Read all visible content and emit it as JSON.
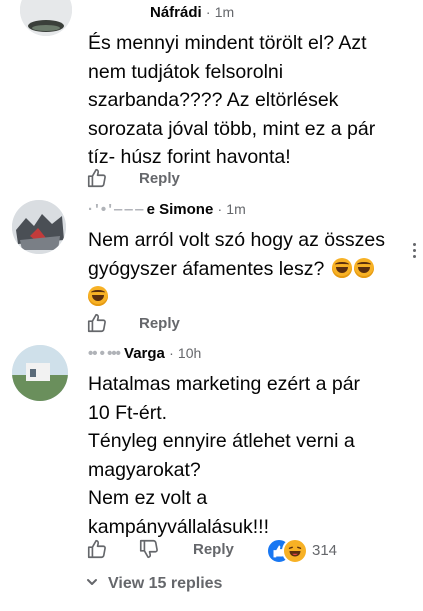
{
  "comments": [
    {
      "author_obscured": "",
      "author": "Náfrádi",
      "separator": "·",
      "time": "1m",
      "lines": [
        "És mennyi mindent törölt el? Azt",
        "nem tudjátok felsorolni",
        "szarbanda???? Az eltörlések",
        "sorozata jóval több, mint ez a pár",
        "tíz- húsz forint havonta!"
      ],
      "reply_label": "Reply"
    },
    {
      "author_obscured": "· ' • ' ‒ ‒ ‒",
      "author": "e Simone",
      "separator": "·",
      "time": "1m",
      "lines": [
        "Nem arról volt szó hogy az összes",
        "gyógyszer áfamentes lesz?"
      ],
      "emoji": "rolling-on-floor-laughing",
      "reply_label": "Reply"
    },
    {
      "author_obscured": "•• • •••",
      "author": "Varga",
      "separator": "·",
      "time": "10h",
      "lines": [
        "Hatalmas marketing ezért a pár",
        "10 Ft-ért.",
        "Tényleg ennyire átlehet verni a",
        "magyarokat?",
        "Nem ez volt a",
        "kampányvállalásuk!!!"
      ],
      "reply_label": "Reply",
      "reaction_count": "314"
    }
  ],
  "view_replies": "View 15 replies",
  "colors": {
    "text": "#050505",
    "secondary": "#65676b",
    "like_blue": "#1877f2",
    "haha_yellow": "#f7b125"
  }
}
